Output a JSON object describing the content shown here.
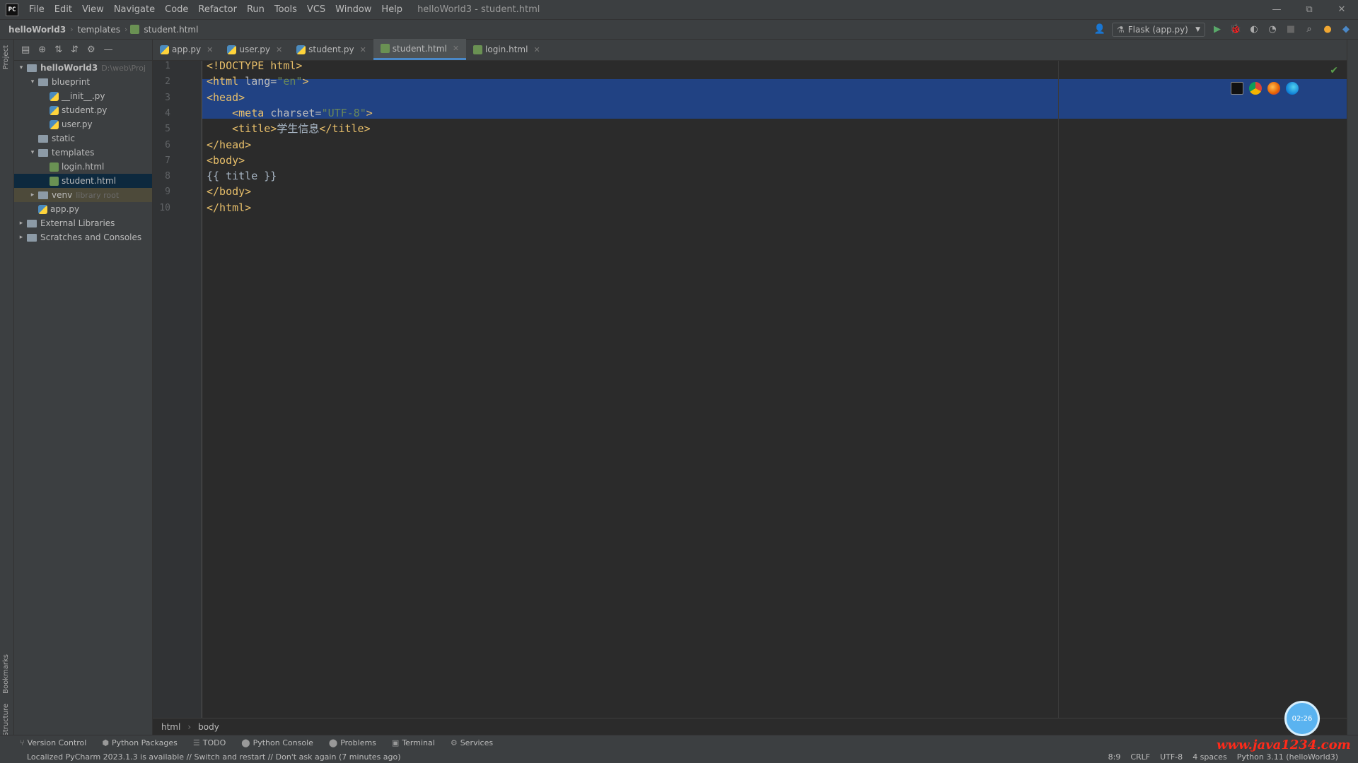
{
  "menubar": {
    "logo": "PC",
    "items": [
      "File",
      "Edit",
      "View",
      "Navigate",
      "Code",
      "Refactor",
      "Run",
      "Tools",
      "VCS",
      "Window",
      "Help"
    ],
    "window_title": "helloWorld3 - student.html",
    "win_minimize": "—",
    "win_maximize": "⧉",
    "win_close": "✕"
  },
  "navbar": {
    "project": "helloWorld3",
    "folder": "templates",
    "file": "student.html",
    "run_config": "Flask (app.py)"
  },
  "project_panel": {
    "tree": [
      {
        "label": "helloWorld3",
        "hint": "D:\\web\\Proj",
        "depth": 0,
        "arrow": "▾",
        "icon": "folder",
        "bold": true
      },
      {
        "label": "blueprint",
        "hint": "",
        "depth": 1,
        "arrow": "▾",
        "icon": "folder"
      },
      {
        "label": "__init__.py",
        "hint": "",
        "depth": 2,
        "arrow": "",
        "icon": "py"
      },
      {
        "label": "student.py",
        "hint": "",
        "depth": 2,
        "arrow": "",
        "icon": "py"
      },
      {
        "label": "user.py",
        "hint": "",
        "depth": 2,
        "arrow": "",
        "icon": "py"
      },
      {
        "label": "static",
        "hint": "",
        "depth": 1,
        "arrow": "",
        "icon": "folder"
      },
      {
        "label": "templates",
        "hint": "",
        "depth": 1,
        "arrow": "▾",
        "icon": "folder"
      },
      {
        "label": "login.html",
        "hint": "",
        "depth": 2,
        "arrow": "",
        "icon": "html"
      },
      {
        "label": "student.html",
        "hint": "",
        "depth": 2,
        "arrow": "",
        "icon": "html",
        "selected": true
      },
      {
        "label": "venv",
        "hint": "library root",
        "depth": 1,
        "arrow": "▸",
        "icon": "folder",
        "excluded": true
      },
      {
        "label": "app.py",
        "hint": "",
        "depth": 1,
        "arrow": "",
        "icon": "py"
      },
      {
        "label": "External Libraries",
        "hint": "",
        "depth": 0,
        "arrow": "▸",
        "icon": "folder"
      },
      {
        "label": "Scratches and Consoles",
        "hint": "",
        "depth": 0,
        "arrow": "▸",
        "icon": "folder"
      }
    ]
  },
  "tabs": [
    {
      "label": "app.py",
      "icon": "py",
      "active": false
    },
    {
      "label": "user.py",
      "icon": "py",
      "active": false
    },
    {
      "label": "student.py",
      "icon": "py",
      "active": false
    },
    {
      "label": "student.html",
      "icon": "html",
      "active": true
    },
    {
      "label": "login.html",
      "icon": "html",
      "active": false
    }
  ],
  "editor": {
    "line_numbers": [
      "1",
      "2",
      "3",
      "4",
      "5",
      "6",
      "7",
      "8",
      "9",
      "10"
    ],
    "lines": [
      [
        {
          "t": "<!DOCTYPE html>",
          "c": "tag"
        }
      ],
      [
        {
          "t": "<html ",
          "c": "tag"
        },
        {
          "t": "lang=",
          "c": "attr"
        },
        {
          "t": "\"en\"",
          "c": "str"
        },
        {
          "t": ">",
          "c": "tag"
        }
      ],
      [
        {
          "t": "<head>",
          "c": "tag"
        }
      ],
      [
        {
          "t": "    <meta ",
          "c": "tag"
        },
        {
          "t": "charset=",
          "c": "attr"
        },
        {
          "t": "\"UTF-8\"",
          "c": "str"
        },
        {
          "t": ">",
          "c": "tag"
        }
      ],
      [
        {
          "t": "    <title>",
          "c": "tag"
        },
        {
          "t": "学生信息",
          "c": "txt"
        },
        {
          "t": "</title>",
          "c": "tag"
        }
      ],
      [
        {
          "t": "</head>",
          "c": "tag"
        }
      ],
      [
        {
          "t": "<body>",
          "c": "tag"
        }
      ],
      [
        {
          "t": "{{ title }}",
          "c": "txt"
        }
      ],
      [
        {
          "t": "</body>",
          "c": "tag"
        }
      ],
      [
        {
          "t": "</html>",
          "c": "tag"
        }
      ]
    ],
    "breadcrumbs": [
      "html",
      "body"
    ]
  },
  "bottom_tools": [
    {
      "icon": "⑂",
      "label": "Version Control"
    },
    {
      "icon": "⬢",
      "label": "Python Packages"
    },
    {
      "icon": "☰",
      "label": "TODO"
    },
    {
      "icon": "⬤",
      "label": "Python Console"
    },
    {
      "icon": "⬤",
      "label": "Problems"
    },
    {
      "icon": "▣",
      "label": "Terminal"
    },
    {
      "icon": "⚙",
      "label": "Services"
    }
  ],
  "statusbar": {
    "message": "Localized PyCharm 2023.1.3 is available // Switch and restart // Don't ask again (7 minutes ago)",
    "position": "8:9",
    "line_ending": "CRLF",
    "encoding": "UTF-8",
    "indent": "4 spaces",
    "interpreter": "Python 3.11 (helloWorld3)"
  },
  "left_strip": {
    "project": "Project",
    "bookmarks": "Bookmarks",
    "structure": "Structure"
  },
  "watermark": "www.java1234.com",
  "timer": "02:26",
  "colors": {
    "accent": "#4a88c7",
    "selection": "#214283",
    "tag": "#e8bf6a",
    "string": "#6a8759"
  }
}
